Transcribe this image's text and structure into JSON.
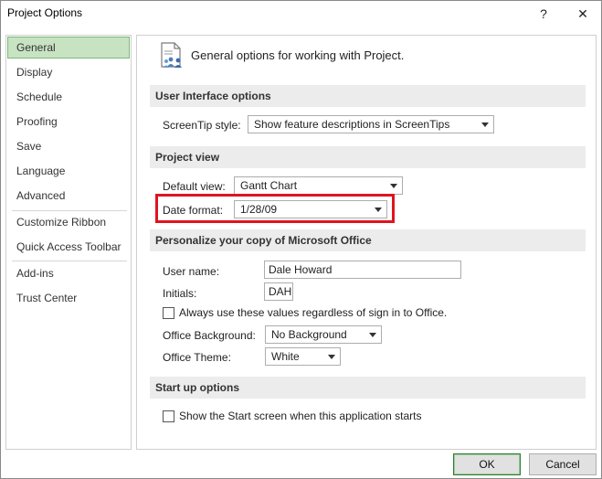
{
  "window": {
    "title": "Project Options",
    "help_glyph": "?",
    "close_glyph": "✕"
  },
  "sidebar": {
    "items": [
      {
        "label": "General"
      },
      {
        "label": "Display"
      },
      {
        "label": "Schedule"
      },
      {
        "label": "Proofing"
      },
      {
        "label": "Save"
      },
      {
        "label": "Language"
      },
      {
        "label": "Advanced"
      },
      {
        "label": "Customize Ribbon"
      },
      {
        "label": "Quick Access Toolbar"
      },
      {
        "label": "Add-ins"
      },
      {
        "label": "Trust Center"
      }
    ],
    "selected_color": "#c7e3c2"
  },
  "main": {
    "header": "General options for working with Project.",
    "sections": {
      "ui": {
        "title": "User Interface options",
        "screentip_label": "ScreenTip style:",
        "screentip_value": "Show feature descriptions in ScreenTips"
      },
      "project_view": {
        "title": "Project view",
        "default_view_label": "Default view:",
        "default_view_value": "Gantt Chart",
        "date_format_label": "Date format:",
        "date_format_value": "1/28/09"
      },
      "personalize": {
        "title": "Personalize your copy of Microsoft Office",
        "user_name_label": "User name:",
        "user_name_value": "Dale Howard",
        "initials_label": "Initials:",
        "initials_value": "DAH",
        "always_use_label": "Always use these values regardless of sign in to Office.",
        "background_label": "Office Background:",
        "background_value": "No Background",
        "theme_label": "Office Theme:",
        "theme_value": "White"
      },
      "startup": {
        "title": "Start up options",
        "show_start_label": "Show the Start screen when this application starts"
      }
    }
  },
  "footer": {
    "ok_label": "OK",
    "cancel_label": "Cancel"
  },
  "colors": {
    "highlight_border": "#e0141e",
    "ok_border": "#2e7d32"
  }
}
